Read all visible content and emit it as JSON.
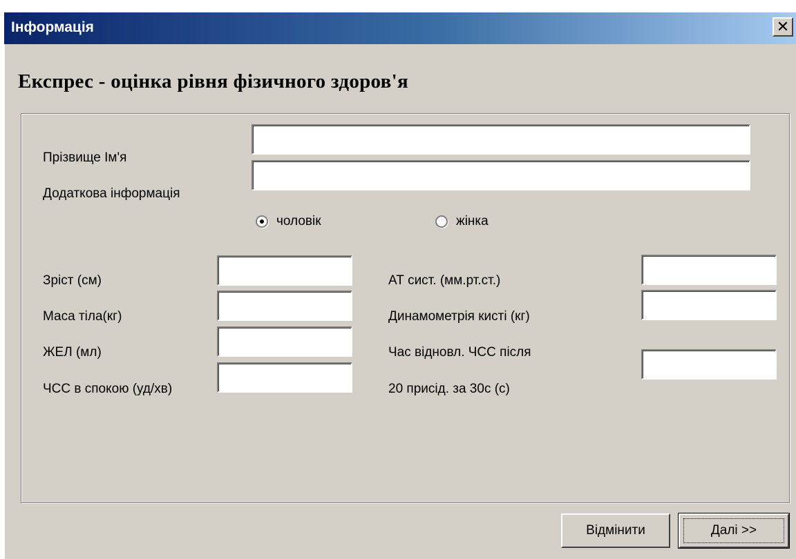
{
  "window": {
    "title": "Інформація",
    "close_glyph": "✕"
  },
  "heading": "Експрес - оцінка рівня фізичного здоров'я",
  "form": {
    "name_label": "Прізвище Ім'я",
    "name_value": "",
    "extra_label": "Додаткова інформація",
    "extra_value": "",
    "gender": {
      "male_label": "чоловік",
      "female_label": "жінка",
      "selected": "male"
    },
    "left_fields": [
      {
        "label": "Зріст (см)",
        "value": ""
      },
      {
        "label": "Маса тіла(кг)",
        "value": ""
      },
      {
        "label": "ЖЕЛ (мл)",
        "value": ""
      },
      {
        "label": "ЧСС в спокою  (уд/хв)",
        "value": ""
      }
    ],
    "right_fields": [
      {
        "label": "АТ сист. (мм.рт.ст.)",
        "value": ""
      },
      {
        "label": "Динамометрія кисті  (кг)",
        "value": ""
      },
      {
        "label_line1": "Час відновл.  ЧСС після",
        "label_line2": "20 присід. за 30с (с)",
        "value": ""
      }
    ]
  },
  "buttons": {
    "cancel": "Відмінити",
    "next": "Далі >>"
  }
}
